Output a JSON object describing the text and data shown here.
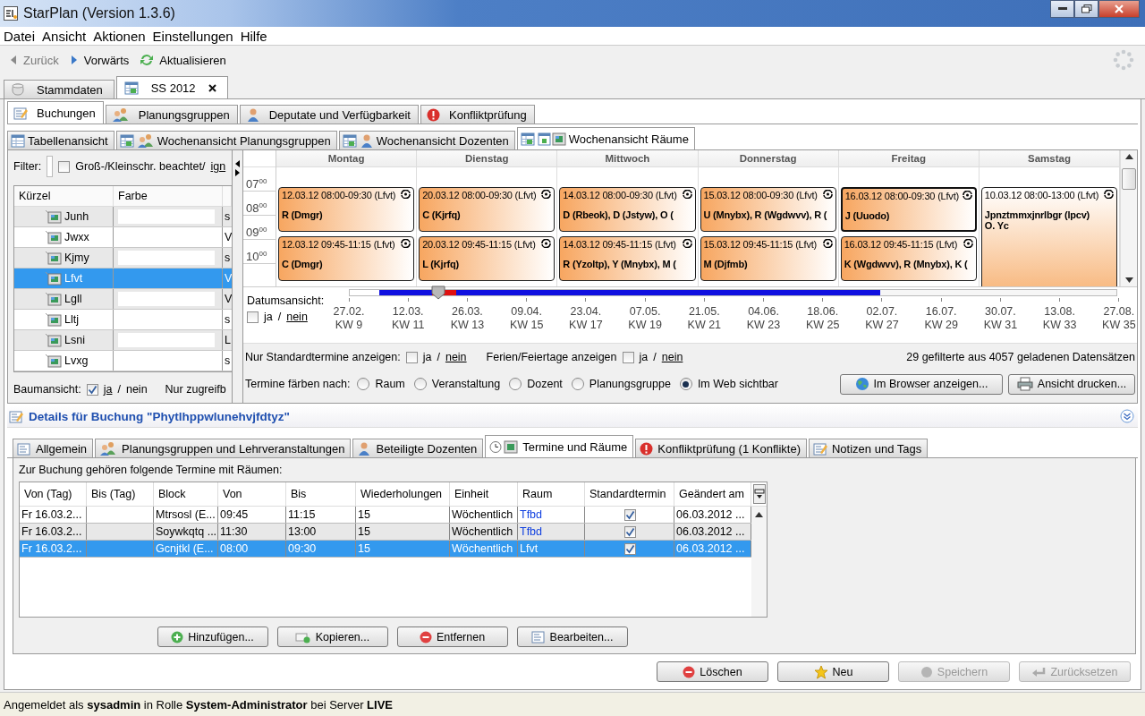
{
  "window": {
    "title": "StarPlan (Version 1.3.6)"
  },
  "menu": [
    "Datei",
    "Ansicht",
    "Aktionen",
    "Einstellungen",
    "Hilfe"
  ],
  "toolbar": [
    {
      "label": "Zurück",
      "kind": "back",
      "disabled": true
    },
    {
      "label": "Vorwärts",
      "kind": "forward",
      "disabled": false
    },
    {
      "label": "Aktualisieren",
      "kind": "refresh",
      "disabled": false
    }
  ],
  "main_tabs": [
    {
      "label": "Stammdaten",
      "kind": "database",
      "selected": false,
      "closable": false
    },
    {
      "label": "SS 2012",
      "kind": "calendar",
      "selected": true,
      "closable": true
    }
  ],
  "section_tabs": [
    {
      "label": "Buchungen",
      "kind": "note",
      "selected": true
    },
    {
      "label": "Planungsgruppen",
      "kind": "group",
      "selected": false
    },
    {
      "label": "Deputate und Verfügbarkeit",
      "kind": "person",
      "selected": false
    },
    {
      "label": "Konfliktprüfung",
      "kind": "alert",
      "selected": false
    }
  ],
  "view_tabs": [
    {
      "label": "Tabellenansicht",
      "kind": "table",
      "selected": false
    },
    {
      "label": "Wochenansicht Planungsgruppen",
      "kind": "group",
      "selected": false
    },
    {
      "label": "Wochenansicht Dozenten",
      "kind": "person",
      "selected": false
    },
    {
      "label": "Wochenansicht Räume",
      "kind": "room",
      "selected": true
    }
  ],
  "left_panel": {
    "filter_label": "Filter:",
    "case_checkbox": {
      "label": "Groß-/Kleinschr. beachtet/",
      "link": "ign",
      "checked": false
    },
    "columns": [
      "Kürzel",
      "Farbe"
    ],
    "rows": [
      {
        "name": "Junh",
        "column_3": "s",
        "selected": false
      },
      {
        "name": "Jwxx",
        "column_3": "V",
        "selected": false
      },
      {
        "name": "Kjmy",
        "column_3": "s",
        "selected": false
      },
      {
        "name": "Lfvt",
        "column_3": "V",
        "selected": true
      },
      {
        "name": "Lgll",
        "column_3": "V",
        "selected": false
      },
      {
        "name": "Lltj",
        "column_3": "s",
        "selected": false
      },
      {
        "name": "Lsni",
        "column_3": "L",
        "selected": false
      },
      {
        "name": "Lvxg",
        "column_3": "s",
        "selected": false
      }
    ],
    "tree_view": {
      "label": "Baumansicht:",
      "checked": true,
      "separator": "/",
      "options": [
        {
          "label": "ja",
          "selected": true
        },
        {
          "label": "nein",
          "selected": false
        }
      ]
    },
    "accessible_label": "Nur zugreifb"
  },
  "calendar": {
    "hours": [
      "07$^{00}$",
      "08$^{00}$",
      "09$^{00}$",
      "10$^{00}$"
    ],
    "days": [
      {
        "name": "Montag",
        "events": [
          {
            "header": "12.03.12 08:00-09:30 (Lfvt)",
            "lines": [
              "R (Dmgr)"
            ],
            "kind": "normal",
            "selected": false
          },
          {
            "header": "12.03.12 09:45-11:15 (Lfvt)",
            "lines": [
              "C (Dmgr)"
            ],
            "kind": "normal",
            "selected": false
          }
        ]
      },
      {
        "name": "Dienstag",
        "events": [
          {
            "header": "20.03.12 08:00-09:30 (Lfvt)",
            "lines": [
              "C (Kjrfq)"
            ],
            "kind": "normal",
            "selected": false
          },
          {
            "header": "20.03.12 09:45-11:15 (Lfvt)",
            "lines": [
              "L (Kjrfq)"
            ],
            "kind": "normal",
            "selected": false
          }
        ]
      },
      {
        "name": "Mittwoch",
        "events": [
          {
            "header": "14.03.12 08:00-09:30 (Lfvt)",
            "lines": [
              "D (Rbeok), D (Jstyw), O ("
            ],
            "kind": "normal",
            "selected": false
          },
          {
            "header": "14.03.12 09:45-11:15 (Lfvt)",
            "lines": [
              "R (Yzoltp), Y (Mnybx), M ("
            ],
            "kind": "normal",
            "selected": false
          }
        ]
      },
      {
        "name": "Donnerstag",
        "events": [
          {
            "header": "15.03.12 08:00-09:30 (Lfvt)",
            "lines": [
              "U (Mnybx), R (Wgdwvv), R ("
            ],
            "kind": "normal",
            "selected": false
          },
          {
            "header": "15.03.12 09:45-11:15 (Lfvt)",
            "lines": [
              "M (Djfmb)"
            ],
            "kind": "normal",
            "selected": false
          }
        ]
      },
      {
        "name": "Freitag",
        "events": [
          {
            "header": "16.03.12 08:00-09:30 (Lfvt)",
            "lines": [
              "J (Uuodo)"
            ],
            "kind": "normal",
            "selected": true
          },
          {
            "header": "16.03.12 09:45-11:15 (Lfvt)",
            "lines": [
              "K (Wgdwvv), R (Mnybx), K ("
            ],
            "kind": "normal",
            "selected": false
          }
        ]
      },
      {
        "name": "Samstag",
        "events": [
          {
            "header": "10.03.12 08:00-13:00 (Lfvt)",
            "lines": [
              "Jpnztmmxjnrlbgr (lpcv)",
              "O. Yc"
            ],
            "kind": "long",
            "selected": false
          }
        ]
      }
    ]
  },
  "timeline": {
    "label": "Datumsansicht:",
    "checked": false,
    "separator": "/",
    "options": [
      {
        "label": "ja",
        "selected": false
      },
      {
        "label": "nein",
        "selected": true
      }
    ],
    "level": 0.115,
    "ticks": [
      {
        "date": "27.02.",
        "week": "KW 9",
        "in_range": true,
        "current": false
      },
      {
        "date": "12.03.",
        "week": "KW 11",
        "in_range": true,
        "current": true
      },
      {
        "date": "26.03.",
        "week": "KW 13",
        "in_range": true,
        "current": false
      },
      {
        "date": "09.04.",
        "week": "KW 15",
        "in_range": true,
        "current": false
      },
      {
        "date": "23.04.",
        "week": "KW 17",
        "in_range": true,
        "current": false
      },
      {
        "date": "07.05.",
        "week": "KW 19",
        "in_range": true,
        "current": false
      },
      {
        "date": "21.05.",
        "week": "KW 21",
        "in_range": true,
        "current": false
      },
      {
        "date": "04.06.",
        "week": "KW 23",
        "in_range": true,
        "current": false
      },
      {
        "date": "18.06.",
        "week": "KW 25",
        "in_range": true,
        "current": false
      },
      {
        "date": "02.07.",
        "week": "KW 27",
        "in_range": false,
        "current": false
      },
      {
        "date": "16.07.",
        "week": "KW 29",
        "in_range": false,
        "current": false
      },
      {
        "date": "30.07.",
        "week": "KW 31",
        "in_range": false,
        "current": false
      },
      {
        "date": "13.08.",
        "week": "KW 33",
        "in_range": false,
        "current": false
      },
      {
        "date": "27.08.",
        "week": "KW 35"
      }
    ]
  },
  "filters": [
    {
      "label": "Nur Standardtermine anzeigen:",
      "checked": false,
      "separator": "/",
      "options": [
        {
          "label": "ja",
          "selected": false
        },
        {
          "label": "nein",
          "selected": true
        }
      ]
    },
    {
      "label": "Ferien/Feiertage anzeigen",
      "checked": false,
      "separator": "/",
      "options": [
        {
          "label": "ja",
          "selected": false
        },
        {
          "label": "nein",
          "selected": true
        }
      ]
    }
  ],
  "record_count": "29 gefilterte aus 4057 geladenen Datensätzen",
  "color_by": {
    "label": "Termine färben nach:",
    "options": [
      {
        "label": "Raum",
        "selected": false
      },
      {
        "label": "Veranstaltung",
        "selected": false
      },
      {
        "label": "Dozent",
        "selected": false
      },
      {
        "label": "Planungsgruppe",
        "selected": false
      },
      {
        "label": "Im Web sichtbar",
        "selected": true
      }
    ]
  },
  "view_buttons": [
    {
      "label": "Im Browser anzeigen...",
      "kind": "globe"
    },
    {
      "label": "Ansicht drucken...",
      "kind": "printer"
    }
  ],
  "details": {
    "title": "Details für Buchung \"Phytlhppwlunehvjfdtyz\"",
    "tabs": [
      {
        "label": "Allgemein",
        "kind": "card",
        "selected": false
      },
      {
        "label": "Planungsgruppen und Lehrveranstaltungen",
        "kind": "group",
        "selected": false
      },
      {
        "label": "Beteiligte Dozenten",
        "kind": "person",
        "selected": false
      },
      {
        "label": "Termine und Räume",
        "kind": "clock",
        "selected": true
      },
      {
        "label": "Konfliktprüfung (1 Konflikte)",
        "kind": "alert",
        "selected": false
      },
      {
        "label": "Notizen und Tags",
        "kind": "note",
        "selected": false
      }
    ],
    "caption": "Zur Buchung gehören folgende Termine mit Räumen:",
    "columns": [
      "Von (Tag)",
      "Bis (Tag)",
      "Block",
      "Von",
      "Bis",
      "Wiederholungen",
      "Einheit",
      "Raum",
      "Standardtermin",
      "Geändert am"
    ],
    "rows": [
      {
        "from_day": "Fr 16.03.2...",
        "to_day": "",
        "block": "Mtrsosl (E...",
        "from": "09:45",
        "to": "11:15",
        "repeats": "15",
        "unit": "Wöchentlich",
        "room": "Tfbd",
        "standard": true,
        "changed": "06.03.2012 ...",
        "selected": false
      },
      {
        "from_day": "Fr 16.03.2...",
        "to_day": "",
        "block": "Soywkqtq ...",
        "from": "11:30",
        "to": "13:00",
        "repeats": "15",
        "unit": "Wöchentlich",
        "room": "Tfbd",
        "standard": true,
        "changed": "06.03.2012 ...",
        "selected": false
      },
      {
        "from_day": "Fr 16.03.2...",
        "to_day": "",
        "block": "Gcnjtkl (E...",
        "from": "08:00",
        "to": "09:30",
        "repeats": "15",
        "unit": "Wöchentlich",
        "room": "Lfvt",
        "standard": true,
        "changed": "06.03.2012 ...",
        "selected": true
      }
    ],
    "buttons": [
      {
        "label": "Hinzufügen...",
        "kind": "plus",
        "disabled": false
      },
      {
        "label": "Kopieren...",
        "kind": "copy",
        "disabled": false
      },
      {
        "label": "Entfernen",
        "kind": "minus",
        "disabled": false
      },
      {
        "label": "Bearbeiten...",
        "kind": "edit",
        "disabled": false
      }
    ]
  },
  "footer_buttons": [
    {
      "label": "Löschen",
      "kind": "minus",
      "disabled": false
    },
    {
      "label": "Neu",
      "kind": "star",
      "disabled": false
    },
    {
      "label": "Speichern",
      "kind": "dot",
      "disabled": true
    },
    {
      "label": "Zurücksetzen",
      "kind": "undo",
      "disabled": true
    }
  ],
  "status_bar": "Angemeldet als **sysadmin** in Rolle **System-Administrator** bei Server **LIVE**"
}
